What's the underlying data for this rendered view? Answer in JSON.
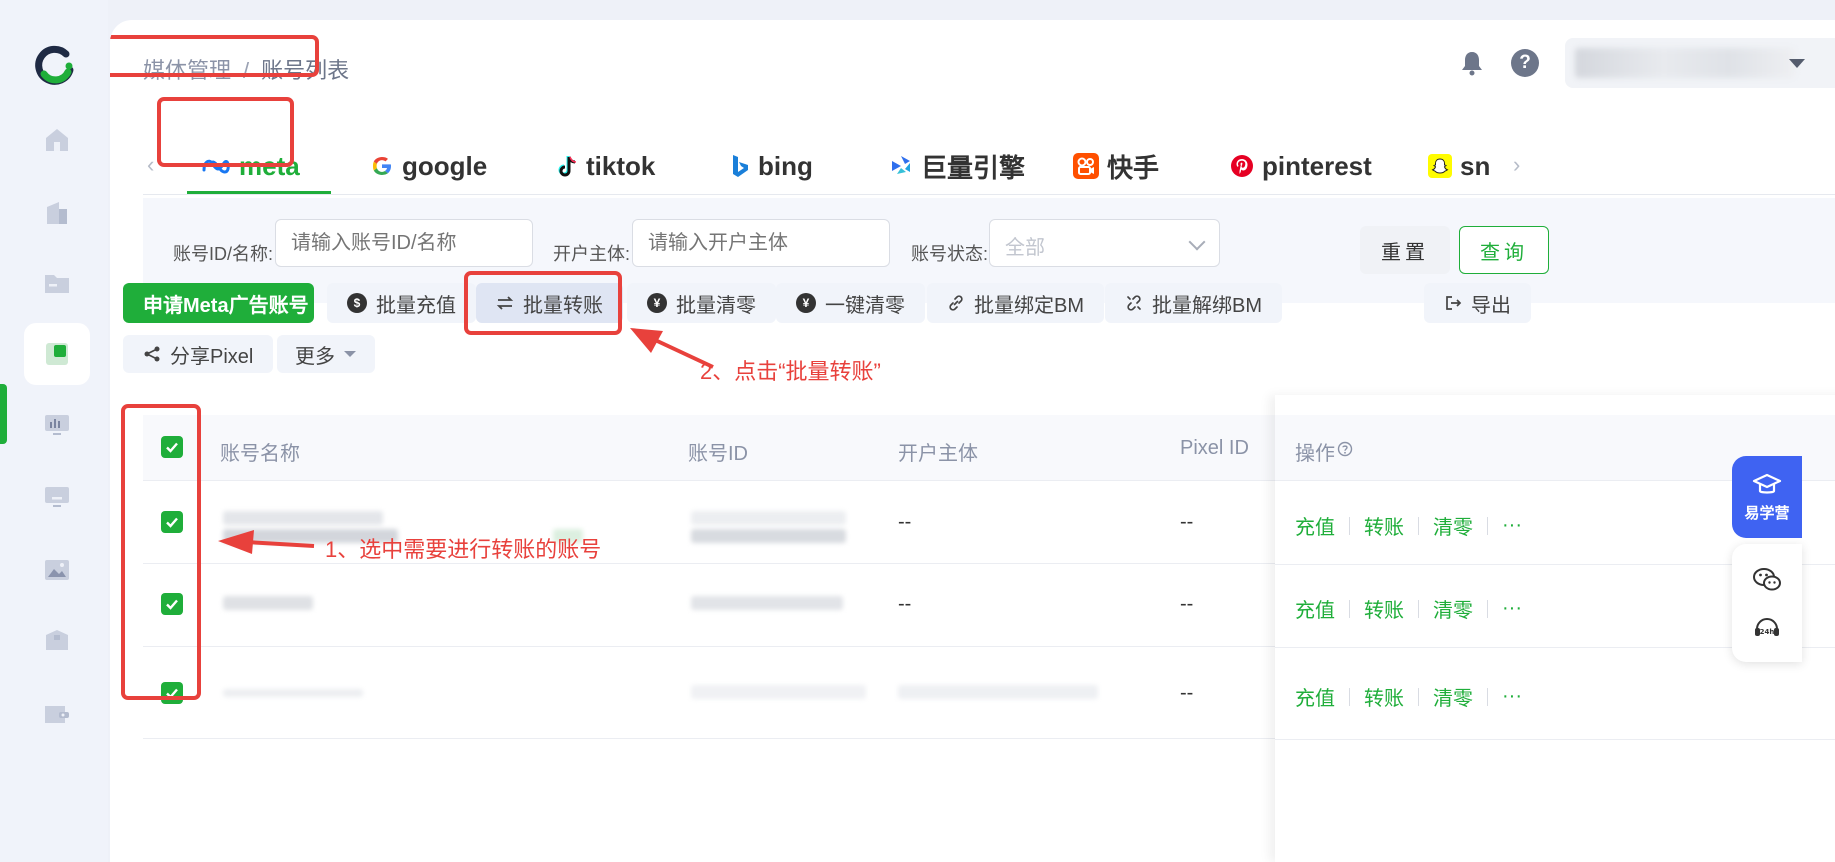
{
  "breadcrumb": {
    "parent": "媒体管理",
    "separator": "/",
    "current": "账号列表"
  },
  "header": {
    "help_symbol": "?"
  },
  "tabs": [
    {
      "label": "meta",
      "icon": "meta-icon",
      "active": true
    },
    {
      "label": "google",
      "icon": "google-icon"
    },
    {
      "label": "tiktok",
      "icon": "tiktok-icon"
    },
    {
      "label": "bing",
      "icon": "bing-icon"
    },
    {
      "label": "巨量引擎",
      "icon": "oceanengine-icon"
    },
    {
      "label": "快手",
      "icon": "kuaishou-icon"
    },
    {
      "label": "pinterest",
      "icon": "pinterest-icon"
    },
    {
      "label": "sn",
      "icon": "snapchat-icon"
    }
  ],
  "filters": {
    "account_label": "账号ID/名称:",
    "account_placeholder": "请输入账号ID/名称",
    "entity_label": "开户主体:",
    "entity_placeholder": "请输入开户主体",
    "status_label": "账号状态:",
    "status_value": "全部",
    "reset_label": "重置",
    "query_label": "查询"
  },
  "actions": {
    "apply": "申请Meta广告账号",
    "batch_recharge": "批量充值",
    "batch_transfer": "批量转账",
    "batch_clear": "批量清零",
    "one_click_clear": "一键清零",
    "batch_bind_bm": "批量绑定BM",
    "batch_unbind_bm": "批量解绑BM",
    "export": "导出",
    "share_pixel": "分享Pixel",
    "more": "更多",
    "yen_symbol": "¥"
  },
  "annotations": {
    "step1": "1、选中需要进行转账的账号",
    "step2": "2、点击“批量转账”"
  },
  "table": {
    "columns": {
      "name": "账号名称",
      "id": "账号ID",
      "entity": "开户主体",
      "pixel": "Pixel ID",
      "ops": "操作"
    },
    "rows": [
      {
        "entity": "--",
        "pixel": "--",
        "checked": true
      },
      {
        "entity": "--",
        "pixel": "--",
        "checked": true
      },
      {
        "entity": "",
        "pixel": "--",
        "checked": true
      }
    ],
    "op_labels": {
      "recharge": "充值",
      "transfer": "转账",
      "clear": "清零",
      "more": "···"
    },
    "header_checked": true
  },
  "floating": {
    "edu_label": "易学营"
  },
  "colors": {
    "accent": "#1fae3a",
    "annotation": "#e8413c",
    "floating_blue": "#3f63f2"
  }
}
